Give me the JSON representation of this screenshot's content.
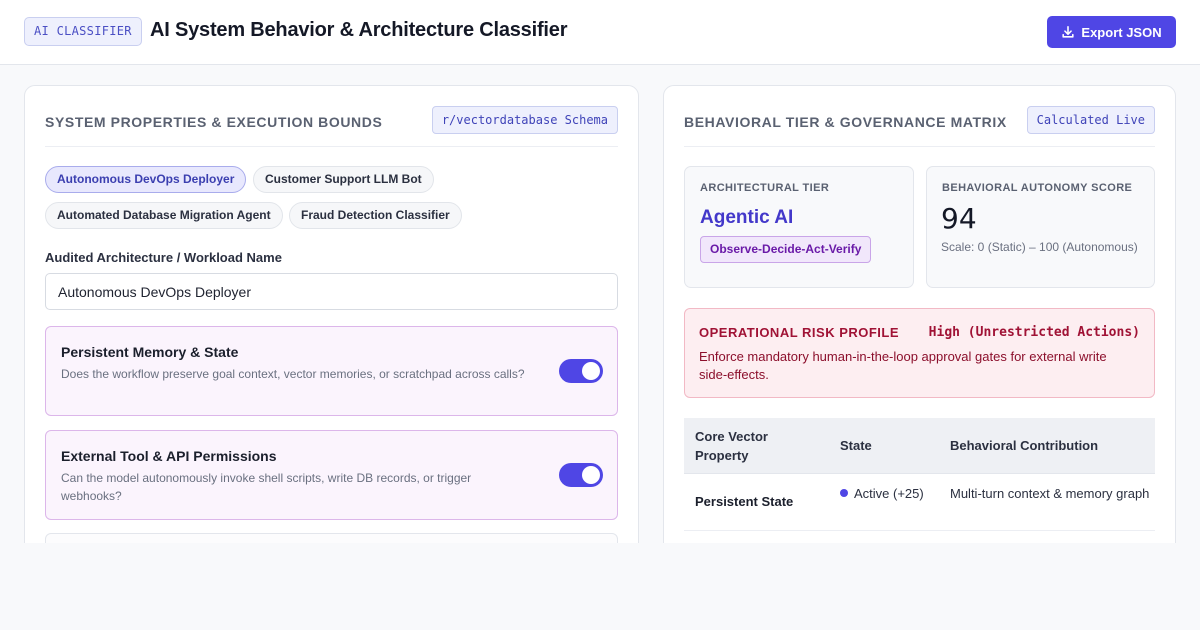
{
  "header": {
    "badge": "AI CLASSIFIER",
    "title": "AI System Behavior & Architecture Classifier",
    "export_label": "Export JSON"
  },
  "left_panel": {
    "title": "SYSTEM PROPERTIES & EXECUTION BOUNDS",
    "tag": "r/vectordatabase Schema",
    "presets": [
      {
        "label": "Autonomous DevOps Deployer",
        "active": true
      },
      {
        "label": "Customer Support LLM Bot",
        "active": false
      },
      {
        "label": "Automated Database Migration Agent",
        "active": false
      },
      {
        "label": "Fraud Detection Classifier",
        "active": false
      }
    ],
    "workload_label": "Audited Architecture / Workload Name",
    "workload_value": "Autonomous DevOps Deployer",
    "toggles": [
      {
        "title": "Persistent Memory & State",
        "description": "Does the workflow preserve goal context, vector memories, or scratchpad across calls?",
        "enabled": true
      },
      {
        "title": "External Tool & API Permissions",
        "description": "Can the model autonomously invoke shell scripts, write DB records, or trigger webhooks?",
        "enabled": true
      }
    ]
  },
  "right_panel": {
    "title": "BEHAVIORAL TIER & GOVERNANCE MATRIX",
    "tag": "Calculated Live",
    "tier": {
      "label": "ARCHITECTURAL TIER",
      "value": "Agentic AI",
      "pattern": "Observe-Decide-Act-Verify"
    },
    "score": {
      "label": "BEHAVIORAL AUTONOMY SCORE",
      "value": "94",
      "scale": "Scale: 0 (Static) – 100 (Autonomous)"
    },
    "risk": {
      "title": "OPERATIONAL RISK PROFILE",
      "level": "High (Unrestricted Actions)",
      "description": "Enforce mandatory human-in-the-loop approval gates for external write side-effects.",
      "color": "#a01235"
    },
    "matrix": {
      "headers": [
        "Core Vector Property",
        "State",
        "Behavioral Contribution"
      ],
      "rows": [
        {
          "property": "Persistent State",
          "state": "Active (+25)",
          "contribution": "Multi-turn context & memory graph"
        }
      ]
    }
  },
  "colors": {
    "accent": "#4f46e5",
    "tier_text": "#4338ca",
    "risk_bg": "#fdeef1"
  }
}
